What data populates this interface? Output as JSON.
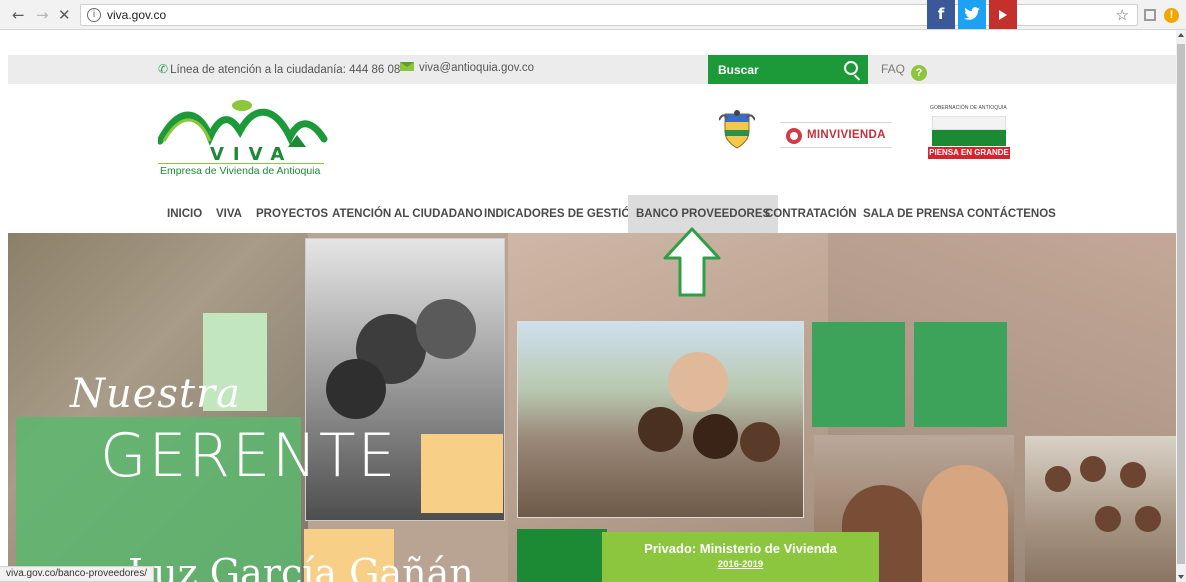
{
  "browser": {
    "url": "viva.gov.co",
    "back_icon": "←",
    "forward_icon": "→",
    "stop_icon": "✕",
    "info_icon": "i",
    "star_icon": "☆",
    "alert_icon": "!"
  },
  "topbar": {
    "phone_text": "Línea de atención a la ciudadanía: 444 86 08",
    "email_text": "viva@antioquia.gov.co",
    "search_label": "Buscar",
    "faq_label": "FAQ",
    "faq_icon": "?",
    "social": {
      "facebook": "f",
      "twitter": "🐦"
    }
  },
  "header": {
    "logo_word": "VIVA",
    "logo_sub": "Empresa de Vivienda de Antioquia",
    "minvivienda": "MINVIVIENDA",
    "gobernacion_title": "GOBERNACIÓN DE ANTIOQUIA",
    "gobernacion_slogan": "PIENSA EN GRANDE"
  },
  "nav": [
    {
      "label": "INICIO"
    },
    {
      "label": "VIVA"
    },
    {
      "label": "PROYECTOS"
    },
    {
      "label": "ATENCIÓN AL CIUDADANO"
    },
    {
      "label": "INDICADORES DE GESTIÓN"
    },
    {
      "label": "BANCO PROVEEDORES"
    },
    {
      "label": "CONTRATACIÓN"
    },
    {
      "label": "SALA DE PRENSA"
    },
    {
      "label": "CONTÁCTENOS"
    }
  ],
  "hero": {
    "line1": "Nuestra",
    "line2": "GERENTE",
    "line3": "Luz García Gañán",
    "caption_title": "Privado: Ministerio de Vivienda",
    "caption_link": "2016-2019"
  },
  "status_url": "viva.gov.co/banco-proveedores/",
  "colors": {
    "brand_green": "#1c9a3a",
    "light_green": "#8cc63f",
    "brand_red": "#d7232d"
  }
}
